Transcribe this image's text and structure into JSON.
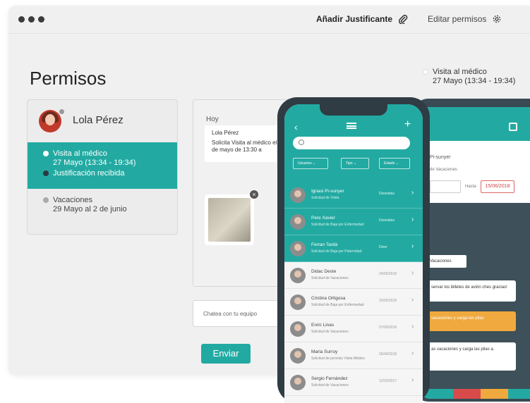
{
  "toolbar": {
    "add_justification": "Añadir Justificante",
    "edit_permissions": "Editar permisos"
  },
  "page": {
    "title": "Permisos"
  },
  "event_tag": {
    "title": "Visita al médico",
    "date": "27 Mayo (13:34 - 19:34)"
  },
  "user": {
    "name": "Lola Pérez",
    "active": {
      "title": "Visita al médico",
      "date": "27 Mayo (13:34 - 19:34)",
      "status": "Justificación recibida"
    },
    "other": {
      "title": "Vacaciones",
      "date": "29 Mayo al 2 de junio"
    }
  },
  "chat": {
    "day": "Hoy",
    "bubble_name": "Lola Pérez",
    "bubble_text": "Solicita Visita al médico el 27 de mayo de 13:30 a",
    "input_placeholder": "Chatea con tu equipo",
    "send_label": "Enviar"
  },
  "phone_list": {
    "filters": [
      "Usuarios",
      "Tipo",
      "Estado"
    ],
    "items": [
      {
        "name": "Ignasi Pi-sunyer",
        "sub": "Solicitud de Visita",
        "date": "Diversitas",
        "style": "teal"
      },
      {
        "name": "Pere Xavier",
        "sub": "Solicitud de Baja por Enfermedad",
        "date": "Diversitas",
        "style": "teal"
      },
      {
        "name": "Ferran Tardà",
        "sub": "Solicitud de Baja por Paternidad",
        "date": "Diver",
        "style": "teal"
      },
      {
        "name": "Didac Deste",
        "sub": "Solicitud de Vacaciones",
        "date": "24/05/2018",
        "style": "grey"
      },
      {
        "name": "Cristina Ortigosa",
        "sub": "Solicitud de Baja por Enfermedad",
        "date": "23/05/2018",
        "style": "grey"
      },
      {
        "name": "Enric Linas",
        "sub": "Solicitud de Vacaciones",
        "date": "07/05/2018",
        "style": "grey"
      },
      {
        "name": "Maria Surroy",
        "sub": "Solicitud de permiso Visita Médico",
        "date": "26/04/2018",
        "style": "grey"
      },
      {
        "name": "Sergio Fernández",
        "sub": "Solicitud de Vacaciones",
        "date": "12/03/2017",
        "style": "grey"
      }
    ]
  },
  "phone_detail": {
    "name_partial": "Pi-sunyer",
    "label_partial": "de Vacaciones",
    "hasta_label": "Hasta",
    "date": "15/06/2018",
    "pill": "Vacaciones",
    "msg1": "servar los billetes de avión ches gracias!",
    "msg2": "vacaciones y carga las pilas",
    "msg3": "as vacaciones y carga las pilas a."
  },
  "colors": {
    "accent": "#22aaa2",
    "dark_panel": "#3e5059",
    "orange": "#f0a93e"
  }
}
